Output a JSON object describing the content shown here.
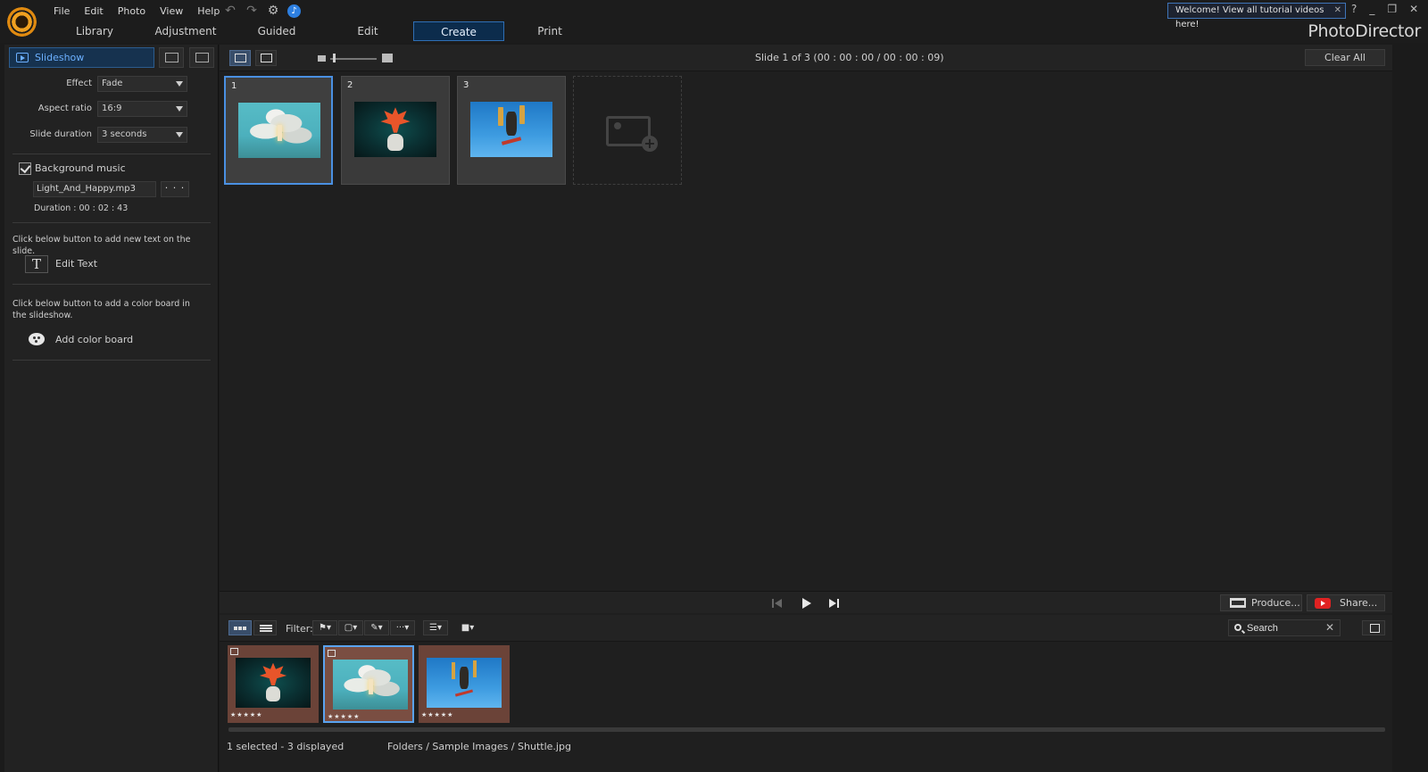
{
  "menu": [
    "File",
    "Edit",
    "Photo",
    "View",
    "Help"
  ],
  "welcome": "Welcome! View all tutorial videos here!",
  "window_controls": [
    "?",
    "_",
    "❐",
    "✕"
  ],
  "tabs": [
    "Library",
    "Adjustment",
    "Guided",
    "Edit",
    "Create",
    "Print"
  ],
  "active_tab": "Create",
  "brand": "PhotoDirector",
  "left": {
    "title": "Slideshow",
    "effect_label": "Effect",
    "effect_value": "Fade",
    "aspect_label": "Aspect ratio",
    "aspect_value": "16:9",
    "duration_label": "Slide duration",
    "duration_value": "3 seconds",
    "bgmusic_label": "Background music",
    "music_file": "Light_And_Happy.mp3",
    "dots": "· · ·",
    "music_duration": "Duration : 00 : 02 : 43",
    "text_hint": "Click below button to add new text on the slide.",
    "edit_text": "Edit Text",
    "t_glyph": "T",
    "color_hint": "Click below button to add a color board in the slideshow.",
    "add_color": "Add color board"
  },
  "toolbar": {
    "slide_info": "Slide    1 of    3 (00 : 00 : 00 / 00 : 00 : 09)",
    "clear_all": "Clear All"
  },
  "slides": [
    {
      "num": "1",
      "image": "shuttle"
    },
    {
      "num": "2",
      "image": "leaf"
    },
    {
      "num": "3",
      "image": "skater"
    }
  ],
  "controls": {
    "produce": "Produce...",
    "share": "Share..."
  },
  "browser": {
    "filter_label": "Filter:",
    "search_placeholder": "Search",
    "filmstrip": [
      {
        "image": "leaf",
        "stars": "★★★★★"
      },
      {
        "image": "shuttle",
        "stars": "★★★★★",
        "selected": true
      },
      {
        "image": "skater",
        "stars": "★★★★★"
      }
    ]
  },
  "status": {
    "selection": "1 selected - 3 displayed",
    "path": "Folders / Sample Images / Shuttle.jpg"
  },
  "colors": {
    "accent": "#4a90e2",
    "tab_active_bg": "#0c2c4c",
    "filmstrip_bg": "#6b4338"
  }
}
